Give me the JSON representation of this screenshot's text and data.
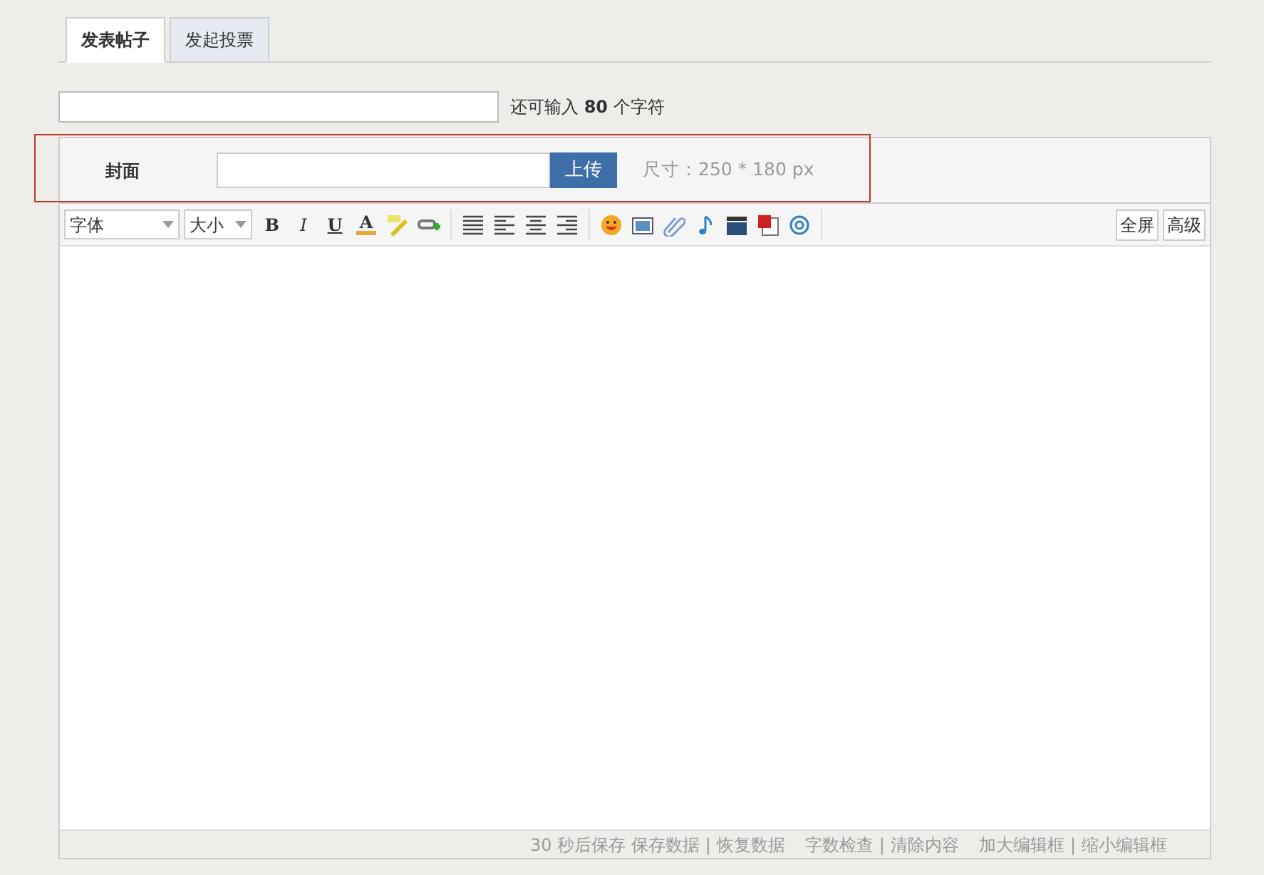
{
  "tabs": [
    {
      "label": "发表帖子",
      "selected": true
    },
    {
      "label": "发起投票",
      "selected": false
    }
  ],
  "title_field": {
    "counter": "还可输入 **80** 个字符"
  },
  "cover": {
    "label": "封面",
    "button": "上传",
    "hint": "尺寸：250 * 180 px",
    "highlighted": true
  },
  "toolbar": {
    "selects": [
      {
        "label": "字体"
      },
      {
        "label": "大小"
      }
    ],
    "format_buttons": [
      {
        "kind": "bold",
        "glyph": "B"
      },
      {
        "kind": "italic",
        "glyph": "I"
      },
      {
        "kind": "underline",
        "glyph": "U"
      },
      {
        "kind": "color",
        "glyph": "A"
      }
    ],
    "right_buttons": [
      "全屏",
      "高级"
    ]
  },
  "status_bar": {
    "autosave": "30 秒后保存",
    "separator": "|",
    "links": [
      [
        "保存数据",
        "恢复数据"
      ],
      [
        "字数检查",
        "清除内容"
      ],
      [
        "加大编辑框",
        "缩小编辑框"
      ]
    ]
  }
}
